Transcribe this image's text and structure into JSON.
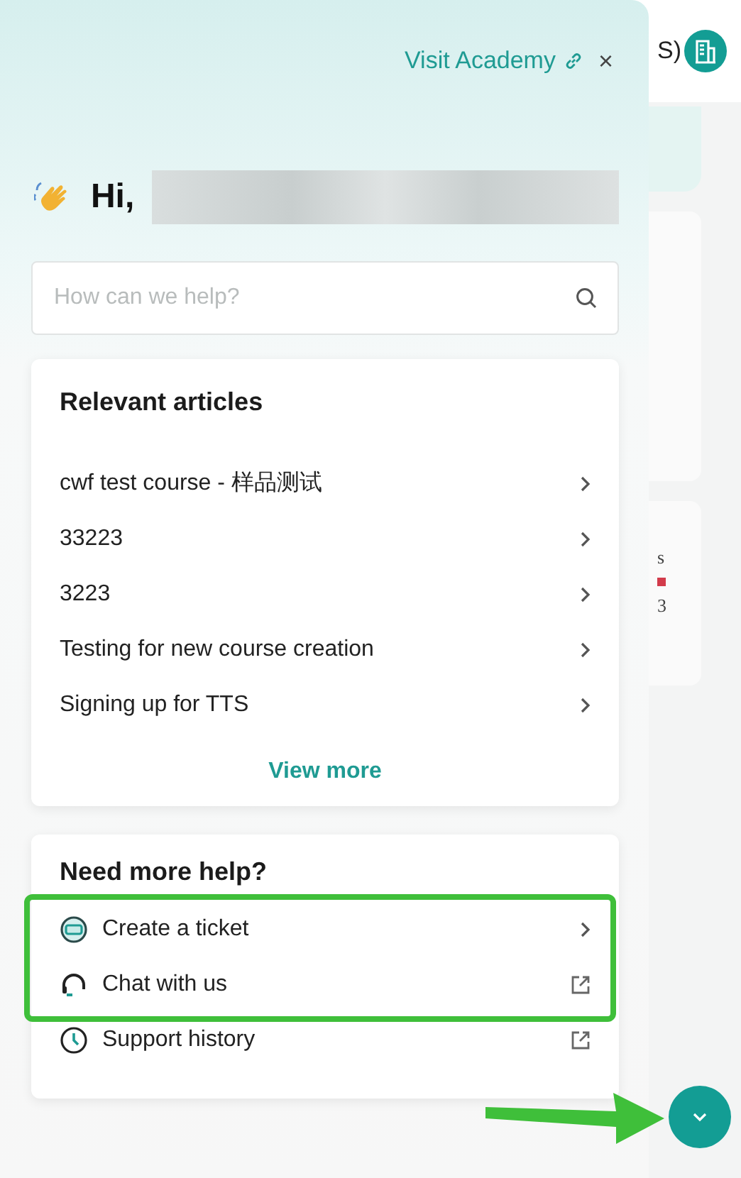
{
  "background_page": {
    "account_label": "S)",
    "side_texts": [
      "s",
      "3"
    ]
  },
  "help_panel": {
    "academy_link": "Visit Academy",
    "close": "×",
    "greeting": {
      "text": "Hi,",
      "name_redacted": true
    },
    "search": {
      "placeholder": "How can we help?"
    },
    "articles": {
      "title": "Relevant articles",
      "items": [
        {
          "title": "cwf test course - 样品测试"
        },
        {
          "title": "33223"
        },
        {
          "title": "3223"
        },
        {
          "title": "Testing for new course creation"
        },
        {
          "title": "Signing up for TTS"
        }
      ],
      "more": "View more"
    },
    "more_help": {
      "title": "Need more help?",
      "items": [
        {
          "kind": "ticket",
          "label": "Create a ticket",
          "trailing": {
            "kind": "chevron"
          },
          "highlighted": true
        },
        {
          "kind": "chat",
          "label": "Chat with us",
          "trailing": {
            "kind": "external"
          },
          "highlighted": true
        },
        {
          "kind": "history",
          "label": "Support history",
          "trailing": {
            "kind": "external"
          },
          "highlighted": false
        }
      ]
    }
  },
  "launcher": {
    "expanded": true
  }
}
